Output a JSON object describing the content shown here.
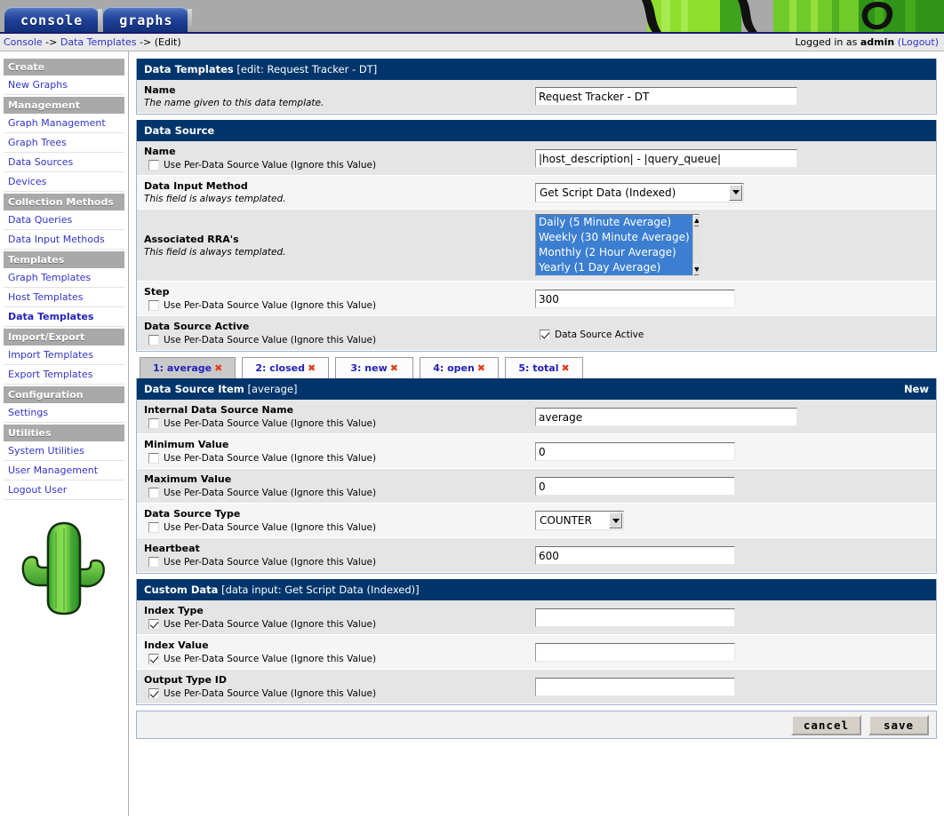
{
  "top_tabs": [
    {
      "label": "console"
    },
    {
      "label": "graphs"
    }
  ],
  "breadcrumb": {
    "console": "Console",
    "sep1": "->",
    "section": "Data Templates",
    "sep2": "->",
    "current": "(Edit)"
  },
  "login": {
    "prefix": "Logged in as",
    "user": "admin",
    "logout": "(Logout)"
  },
  "sidebar": {
    "groups": [
      {
        "head": "Create",
        "items": [
          {
            "label": "New Graphs",
            "selected": false
          }
        ]
      },
      {
        "head": "Management",
        "items": [
          {
            "label": "Graph Management",
            "selected": false
          },
          {
            "label": "Graph Trees",
            "selected": false
          },
          {
            "label": "Data Sources",
            "selected": false
          },
          {
            "label": "Devices",
            "selected": false
          }
        ]
      },
      {
        "head": "Collection Methods",
        "items": [
          {
            "label": "Data Queries",
            "selected": false
          },
          {
            "label": "Data Input Methods",
            "selected": false
          }
        ]
      },
      {
        "head": "Templates",
        "items": [
          {
            "label": "Graph Templates",
            "selected": false
          },
          {
            "label": "Host Templates",
            "selected": false
          },
          {
            "label": "Data Templates",
            "selected": true
          }
        ]
      },
      {
        "head": "Import/Export",
        "items": [
          {
            "label": "Import Templates",
            "selected": false
          },
          {
            "label": "Export Templates",
            "selected": false
          }
        ]
      },
      {
        "head": "Configuration",
        "items": [
          {
            "label": "Settings",
            "selected": false
          }
        ]
      },
      {
        "head": "Utilities",
        "items": [
          {
            "label": "System Utilities",
            "selected": false
          },
          {
            "label": "User Management",
            "selected": false
          },
          {
            "label": "Logout User",
            "selected": false
          }
        ]
      }
    ],
    "logo_name": "cactus-logo"
  },
  "panels": {
    "data_templates": {
      "title": "Data Templates",
      "subtitle": "[edit: Request Tracker - DT]",
      "rows": [
        {
          "label": "Name",
          "hint": "The name given to this data template.",
          "checkbox": null,
          "control": "text",
          "value": "Request Tracker - DT",
          "placeholder": "",
          "width": "w295"
        }
      ]
    },
    "data_source": {
      "title": "Data Source",
      "subtitle": "",
      "rows": [
        {
          "label": "Name",
          "hint": "",
          "checkbox": {
            "label": "Use Per-Data Source Value (Ignore this Value)",
            "checked": false
          },
          "control": "text",
          "value": "|host_description| - |query_queue|",
          "placeholder": "",
          "width": "w295"
        },
        {
          "label": "Data Input Method",
          "hint": "This field is always templated.",
          "checkbox": null,
          "control": "select",
          "value": "Get Script Data (Indexed)",
          "width": "w235"
        },
        {
          "label": "Associated RRA's",
          "hint": "This field is always templated.",
          "checkbox": null,
          "control": "listbox",
          "options": [
            "Daily (5 Minute Average)",
            "Weekly (30 Minute Average)",
            "Monthly (2 Hour Average)",
            "Yearly (1 Day Average)"
          ]
        },
        {
          "label": "Step",
          "hint": "",
          "checkbox": {
            "label": "Use Per-Data Source Value (Ignore this Value)",
            "checked": false
          },
          "control": "text",
          "value": "300",
          "placeholder": "",
          "width": "w225"
        },
        {
          "label": "Data Source Active",
          "hint": "",
          "checkbox": {
            "label": "Use Per-Data Source Value (Ignore this Value)",
            "checked": false
          },
          "control": "checkbox",
          "check_label": "Data Source Active",
          "checked": true
        }
      ]
    },
    "data_source_item": {
      "title": "Data Source Item",
      "subtitle": "[average]",
      "action": "New",
      "rows": [
        {
          "label": "Internal Data Source Name",
          "hint": "",
          "checkbox": {
            "label": "Use Per-Data Source Value (Ignore this Value)",
            "checked": false
          },
          "control": "text",
          "value": "average",
          "placeholder": "",
          "width": "w295"
        },
        {
          "label": "Minimum Value",
          "hint": "",
          "checkbox": {
            "label": "Use Per-Data Source Value (Ignore this Value)",
            "checked": false
          },
          "control": "text",
          "value": "0",
          "placeholder": "",
          "width": "w225"
        },
        {
          "label": "Maximum Value",
          "hint": "",
          "checkbox": {
            "label": "Use Per-Data Source Value (Ignore this Value)",
            "checked": false
          },
          "control": "text",
          "value": "0",
          "placeholder": "",
          "width": "w225"
        },
        {
          "label": "Data Source Type",
          "hint": "",
          "checkbox": {
            "label": "Use Per-Data Source Value (Ignore this Value)",
            "checked": false
          },
          "control": "select",
          "value": "COUNTER",
          "width": "w100"
        },
        {
          "label": "Heartbeat",
          "hint": "",
          "checkbox": {
            "label": "Use Per-Data Source Value (Ignore this Value)",
            "checked": false
          },
          "control": "text",
          "value": "600",
          "placeholder": "",
          "width": "w225"
        }
      ]
    },
    "custom_data": {
      "title": "Custom Data",
      "subtitle": "[data input: Get Script Data (Indexed)]",
      "rows": [
        {
          "label": "Index Type",
          "hint": "",
          "checkbox": {
            "label": "Use Per-Data Source Value (Ignore this Value)",
            "checked": true
          },
          "control": "text",
          "value": "",
          "placeholder": "",
          "width": "w225"
        },
        {
          "label": "Index Value",
          "hint": "",
          "checkbox": {
            "label": "Use Per-Data Source Value (Ignore this Value)",
            "checked": true
          },
          "control": "text",
          "value": "",
          "placeholder": "",
          "width": "w225"
        },
        {
          "label": "Output Type ID",
          "hint": "",
          "checkbox": {
            "label": "Use Per-Data Source Value (Ignore this Value)",
            "checked": true
          },
          "control": "text",
          "value": "",
          "placeholder": "",
          "width": "w225"
        }
      ]
    }
  },
  "item_tabs": [
    {
      "label": "1: average",
      "active": true,
      "close": "✖"
    },
    {
      "label": "2: closed",
      "active": false,
      "close": "✖"
    },
    {
      "label": "3: new",
      "active": false,
      "close": "✖"
    },
    {
      "label": "4: open",
      "active": false,
      "close": "✖"
    },
    {
      "label": "5: total",
      "active": false,
      "close": "✖"
    }
  ],
  "actions": {
    "cancel": "cancel",
    "save": "save"
  },
  "colors": {
    "panel_header": "#00356b",
    "nav_header": "#a9a9a9",
    "link": "#3333cc",
    "selection": "#3c7fd1",
    "close_x": "#e23b16",
    "banner_green": "#5cc022"
  }
}
